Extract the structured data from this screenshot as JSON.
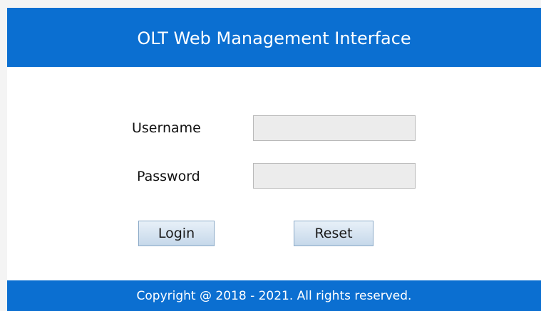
{
  "header": {
    "title": "OLT Web Management Interface"
  },
  "form": {
    "username_label": "Username",
    "username_value": "",
    "password_label": "Password",
    "password_value": "",
    "login_label": "Login",
    "reset_label": "Reset"
  },
  "footer": {
    "copyright": "Copyright @ 2018 - 2021. All rights reserved."
  },
  "colors": {
    "brand_blue": "#0b6fd1",
    "input_background": "#ececec",
    "button_background": "#d6e4f1"
  }
}
